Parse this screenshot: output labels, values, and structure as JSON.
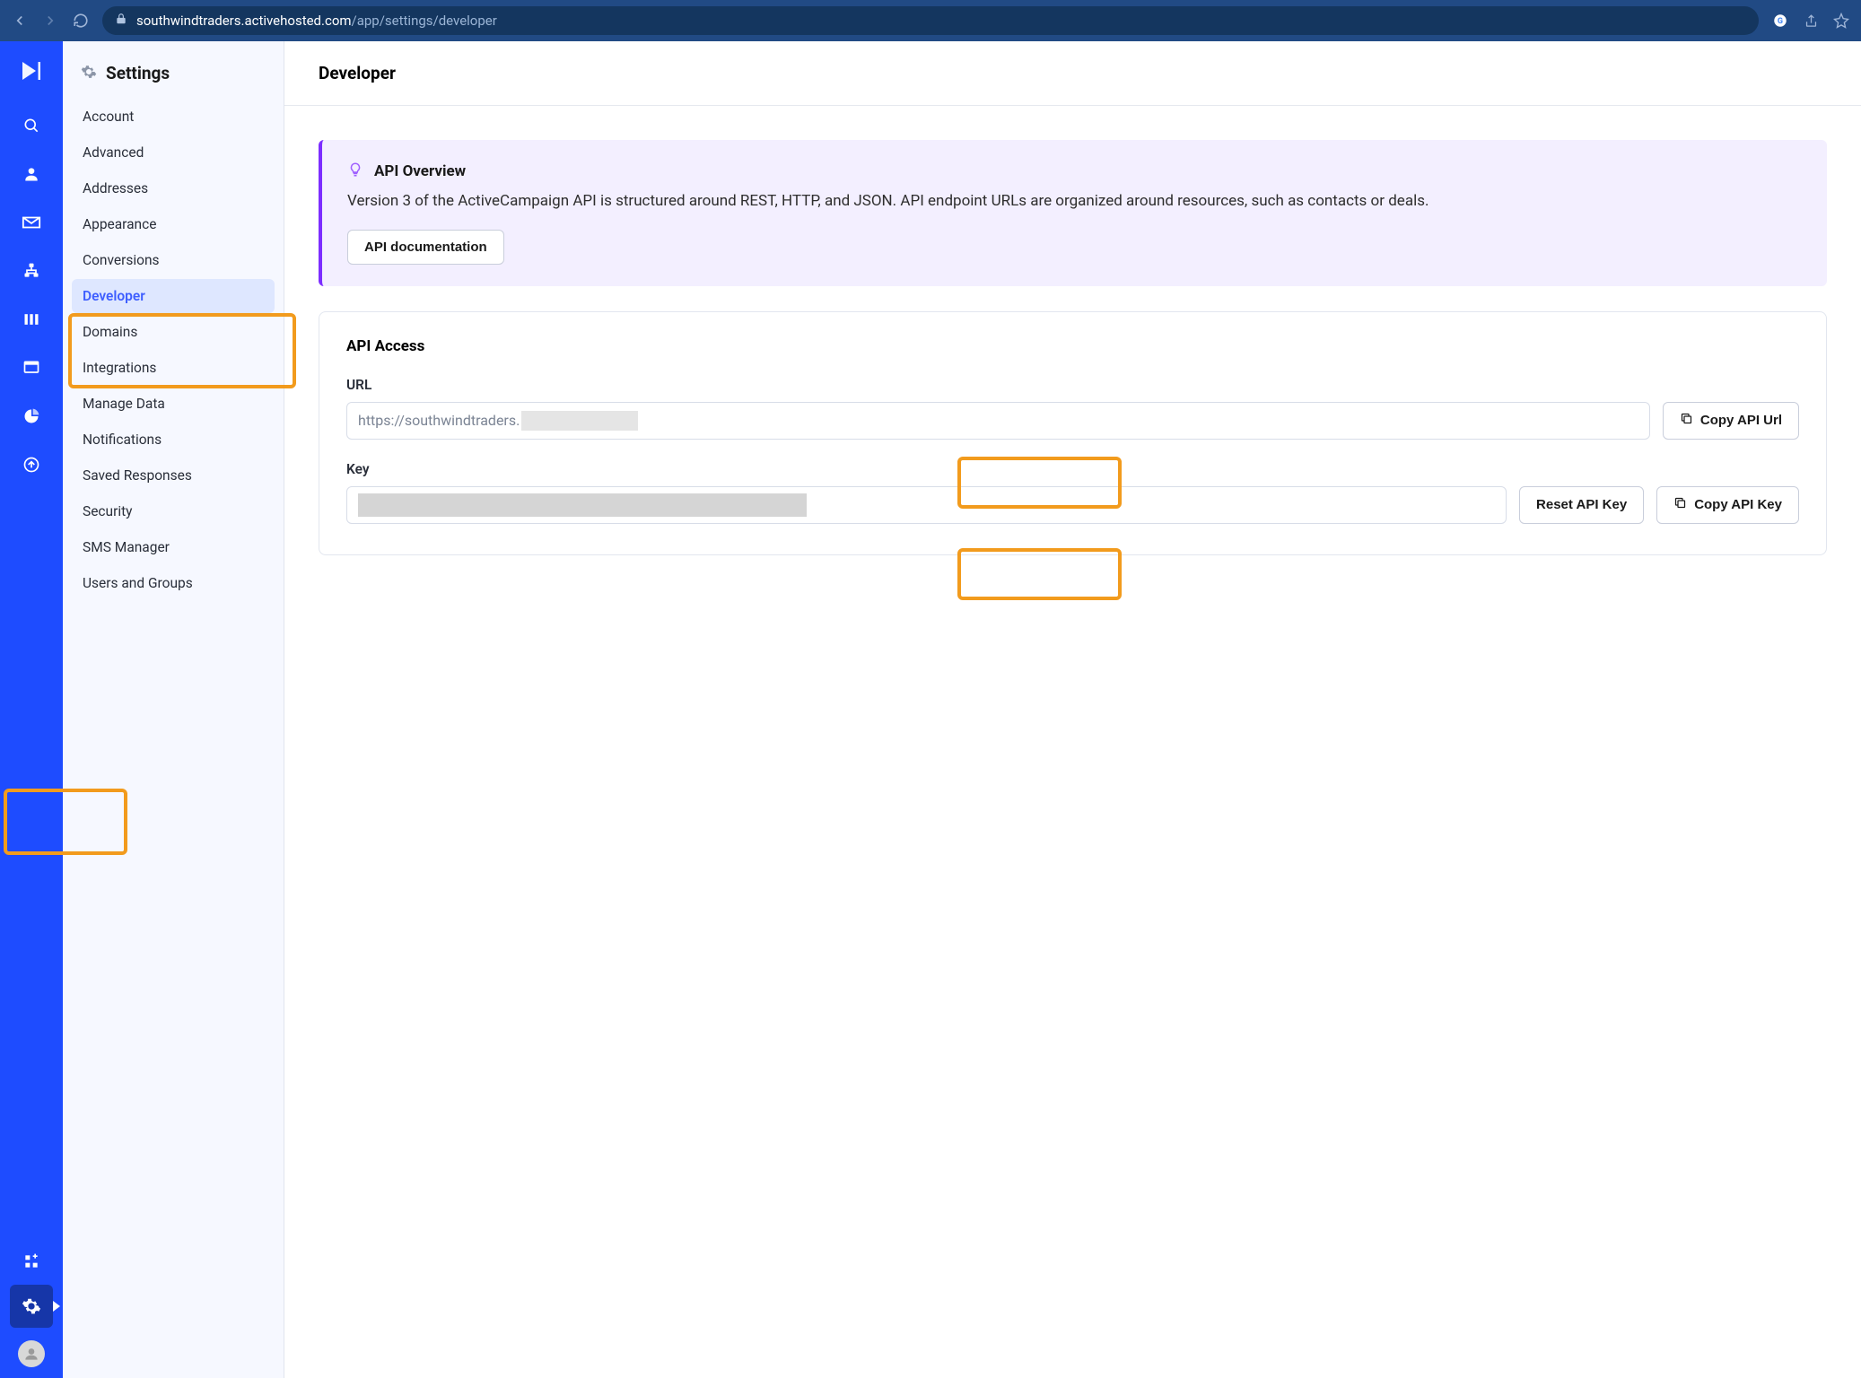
{
  "browser": {
    "url_host": "southwindtraders.activehosted.com",
    "url_path": "/app/settings/developer"
  },
  "settings": {
    "title": "Settings",
    "items": [
      "Account",
      "Advanced",
      "Addresses",
      "Appearance",
      "Conversions",
      "Developer",
      "Domains",
      "Integrations",
      "Manage Data",
      "Notifications",
      "Saved Responses",
      "Security",
      "SMS Manager",
      "Users and Groups"
    ],
    "active_index": 5
  },
  "page": {
    "title": "Developer",
    "overview": {
      "heading": "API Overview",
      "body": "Version 3 of the ActiveCampaign API is structured around REST, HTTP, and JSON. API endpoint URLs are organized around resources, such as contacts or deals.",
      "doc_button": "API documentation"
    },
    "access": {
      "heading": "API Access",
      "url_label": "URL",
      "url_value": "https://southwindtraders.",
      "copy_url": "Copy API Url",
      "key_label": "Key",
      "reset_key": "Reset API Key",
      "copy_key": "Copy API Key"
    }
  }
}
